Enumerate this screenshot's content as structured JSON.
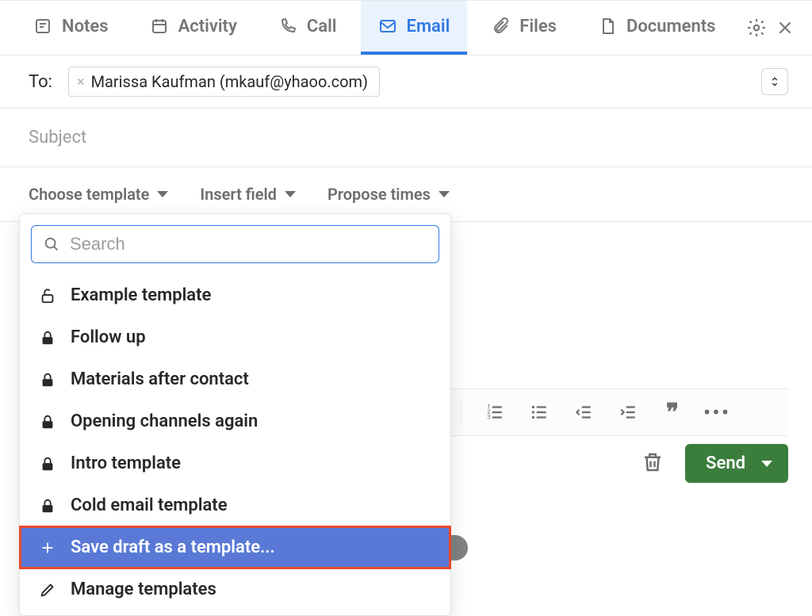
{
  "tabs": {
    "notes": "Notes",
    "activity": "Activity",
    "call": "Call",
    "email": "Email",
    "files": "Files",
    "documents": "Documents"
  },
  "compose": {
    "to_label": "To:",
    "recipient": "Marissa Kaufman (mkauf@yhaoo.com)",
    "subject_placeholder": "Subject"
  },
  "menubar": {
    "choose_template": "Choose template",
    "insert_field": "Insert field",
    "propose_times": "Propose times"
  },
  "template_dropdown": {
    "search_placeholder": "Search",
    "items": [
      {
        "label": "Example template",
        "locked": false
      },
      {
        "label": "Follow up",
        "locked": true
      },
      {
        "label": "Materials after contact",
        "locked": true
      },
      {
        "label": "Opening channels again",
        "locked": true
      },
      {
        "label": "Intro template",
        "locked": true
      },
      {
        "label": "Cold email template",
        "locked": true
      }
    ],
    "save_draft": "Save draft as a template...",
    "manage": "Manage templates"
  },
  "actions": {
    "send": "Send"
  }
}
